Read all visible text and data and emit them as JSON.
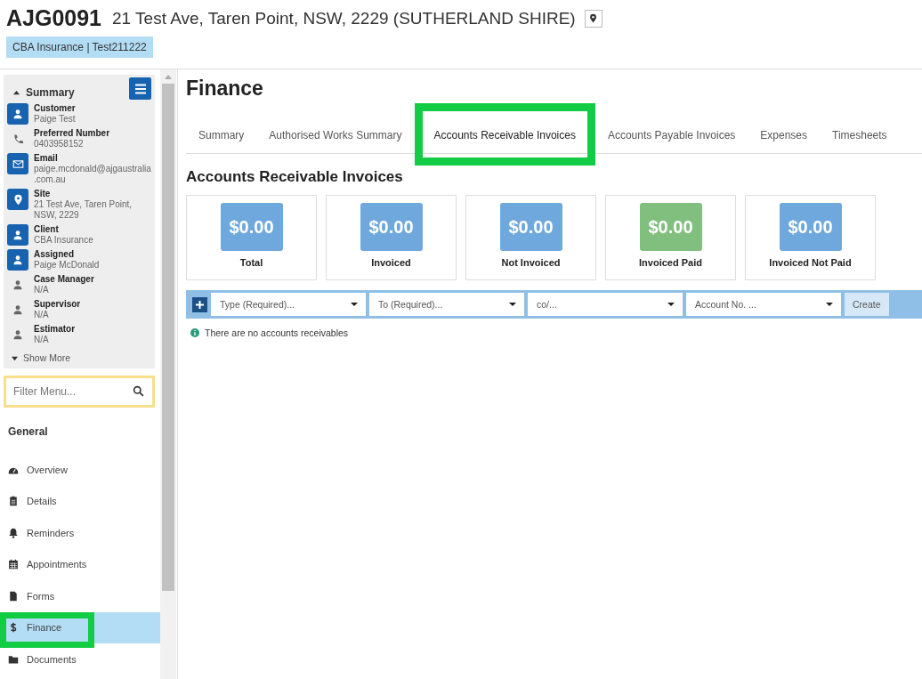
{
  "header": {
    "job_number": "AJG0091",
    "address": "21 Test Ave, Taren Point, NSW, 2229 (SUTHERLAND SHIRE)",
    "tag": "CBA Insurance | Test211222"
  },
  "summary": {
    "title": "Summary",
    "expanded": true,
    "items": [
      {
        "label": "Customer",
        "value": "Paige Test",
        "kind": "person",
        "boxed": true
      },
      {
        "label": "Preferred Number",
        "value": "0403958152",
        "kind": "phone",
        "boxed": false
      },
      {
        "label": "Email",
        "value": "paige.mcdonald@ajgaustralia.com.au",
        "kind": "email",
        "boxed": true
      },
      {
        "label": "Site",
        "value": "21 Test Ave, Taren Point, NSW, 2229",
        "kind": "pin",
        "boxed": true
      },
      {
        "label": "Client",
        "value": "CBA Insurance",
        "kind": "person",
        "boxed": true
      },
      {
        "label": "Assigned",
        "value": "Paige McDonald",
        "kind": "person",
        "boxed": true
      },
      {
        "label": "Case Manager",
        "value": "N/A",
        "kind": "person",
        "boxed": false
      },
      {
        "label": "Supervisor",
        "value": "N/A",
        "kind": "person",
        "boxed": false
      },
      {
        "label": "Estimator",
        "value": "N/A",
        "kind": "person",
        "boxed": false
      }
    ],
    "show_more": "Show More"
  },
  "filter": {
    "placeholder": "Filter Menu..."
  },
  "nav": {
    "heading": "General",
    "items": [
      {
        "label": "Overview",
        "kind": "dashboard",
        "selected": false,
        "highlighted": false
      },
      {
        "label": "Details",
        "kind": "clipboard",
        "selected": false,
        "highlighted": false
      },
      {
        "label": "Reminders",
        "kind": "bell",
        "selected": false,
        "highlighted": false
      },
      {
        "label": "Appointments",
        "kind": "calendar",
        "selected": false,
        "highlighted": false
      },
      {
        "label": "Forms",
        "kind": "file",
        "selected": false,
        "highlighted": false
      },
      {
        "label": "Finance",
        "kind": "dollar",
        "selected": true,
        "highlighted": true
      },
      {
        "label": "Documents",
        "kind": "folder",
        "selected": false,
        "highlighted": false
      }
    ]
  },
  "page_title": "Finance",
  "tabs": [
    {
      "label": "Summary",
      "selected": false,
      "highlighted": false
    },
    {
      "label": "Authorised Works Summary",
      "selected": false,
      "highlighted": false
    },
    {
      "label": "Accounts Receivable Invoices",
      "selected": true,
      "highlighted": true
    },
    {
      "label": "Accounts Payable Invoices",
      "selected": false,
      "highlighted": false
    },
    {
      "label": "Expenses",
      "selected": false,
      "highlighted": false
    },
    {
      "label": "Timesheets",
      "selected": false,
      "highlighted": false
    }
  ],
  "section_title": "Accounts Receivable Invoices",
  "totals": [
    {
      "amount": "$0.00",
      "label": "Total",
      "color": "#6fa8dc"
    },
    {
      "amount": "$0.00",
      "label": "Invoiced",
      "color": "#6fa8dc"
    },
    {
      "amount": "$0.00",
      "label": "Not Invoiced",
      "color": "#6fa8dc"
    },
    {
      "amount": "$0.00",
      "label": "Invoiced Paid",
      "color": "#81bf7f"
    },
    {
      "amount": "$0.00",
      "label": "Invoiced Not Paid",
      "color": "#6fa8dc"
    }
  ],
  "toolbar": {
    "selects": [
      {
        "placeholder": "Type (Required)..."
      },
      {
        "placeholder": "To (Required)..."
      },
      {
        "placeholder": "co/..."
      },
      {
        "placeholder": "Account No. ..."
      }
    ],
    "create_button": "Create"
  },
  "empty_message": "There are no accounts receivables"
}
